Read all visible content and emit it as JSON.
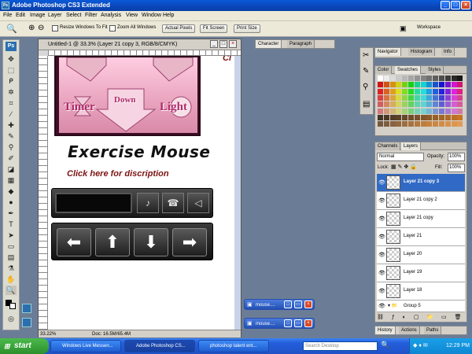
{
  "window": {
    "title": "Adobe Photoshop CS3 Extended",
    "app_icon": "Ps"
  },
  "menu": [
    "File",
    "Edit",
    "Image",
    "Layer",
    "Select",
    "Filter",
    "Analysis",
    "View",
    "Window",
    "Help"
  ],
  "options": {
    "resize_windows": "Resize Windows To Fit",
    "zoom_all": "Zoom All Windows",
    "actual_pixels": "Actual Pixels",
    "fit_screen": "Fit Screen",
    "print_size": "Print Size",
    "workspace": "Workspace"
  },
  "document": {
    "title": "Untitled-1 @ 33.3% (Layer 21 copy 3, RGB/8/CMYK)",
    "zoom": "33.22%",
    "doc_size": "Doc: 16.5M/65.4M"
  },
  "canvas": {
    "pink_buttons": [
      "Timer",
      "Down",
      "Light"
    ],
    "heading": "Exercise Mouse",
    "subheading": "Click here for discription",
    "top_letter": "Ci"
  },
  "panels": {
    "char_tabs": [
      "Character",
      "Paragraph"
    ],
    "nav_tabs": [
      "Navigator",
      "Histogram",
      "Info"
    ],
    "color_tabs": [
      "Color",
      "Swatches",
      "Styles"
    ],
    "layer_tabs": [
      "Channels",
      "Layers"
    ],
    "blend_mode": "Normal",
    "opacity_label": "Opacity:",
    "opacity": "100%",
    "lock_label": "Lock:",
    "fill_label": "Fill:",
    "fill": "100%",
    "history_tabs": [
      "History",
      "Actions",
      "Paths"
    ],
    "layers": [
      "Layer 21 copy 3",
      "Layer 21 copy 2",
      "Layer 21 copy",
      "Layer 21",
      "Layer 20",
      "Layer 19",
      "Layer 18"
    ],
    "group": "Group 5"
  },
  "minimized": [
    "mouse....",
    "mouse...."
  ],
  "taskbar": {
    "start": "start",
    "tasks": [
      "Windows Live Messen...",
      "Adobe Photoshop CS...",
      "photoshop talent ent..."
    ],
    "search": "Search Desktop",
    "clock": "12:29 PM"
  },
  "colors": {
    "titlebar": "#0a46b8",
    "selected_layer": "#316ac5",
    "heading_red": "#7c1212",
    "canvas_mauve": "#e8a3bd"
  }
}
